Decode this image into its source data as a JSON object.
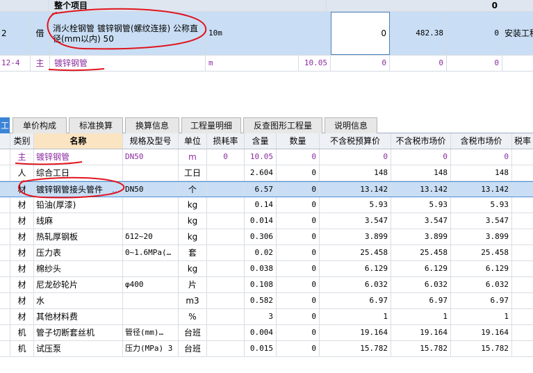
{
  "top": {
    "group_row": {
      "label": "整个项目",
      "total": "0"
    },
    "main_row": {
      "code": "2",
      "type": "借",
      "name": "消火栓钢管 镀锌钢管(螺纹连接) 公称直径(mm以内) 50",
      "unit": "10m",
      "qty": "0",
      "price": "482.38",
      "amount": "0",
      "category": "安装工程"
    },
    "sub_row": {
      "code": "12-4",
      "type": "主",
      "name": "镀锌钢管",
      "unit": "m",
      "content": "10.05",
      "qty": "0",
      "price": "0",
      "amount": "0"
    }
  },
  "tabs": [
    {
      "label": "工"
    },
    {
      "label": "单价构成"
    },
    {
      "label": "标准换算"
    },
    {
      "label": "换算信息"
    },
    {
      "label": "工程量明细"
    },
    {
      "label": "反查图形工程量"
    },
    {
      "label": "说明信息"
    }
  ],
  "table": {
    "headers": [
      "",
      "类别",
      "名称",
      "规格及型号",
      "单位",
      "损耗率",
      "含量",
      "数量",
      "不含税预算价",
      "不含税市场价",
      "含税市场价",
      "税率"
    ],
    "rows": [
      {
        "type": "主",
        "name": "镀锌钢管",
        "spec": "DN50",
        "unit": "m",
        "loss": "0",
        "content": "10.05",
        "qty": "0",
        "p1": "0",
        "p2": "0",
        "p3": "0"
      },
      {
        "type": "人",
        "name": "综合工日",
        "spec": "",
        "unit": "工日",
        "loss": "",
        "content": "2.604",
        "qty": "0",
        "p1": "148",
        "p2": "148",
        "p3": "148"
      },
      {
        "type": "材",
        "name": "镀锌钢管接头管件",
        "spec": "DN50",
        "unit": "个",
        "loss": "",
        "content": "6.57",
        "qty": "0",
        "p1": "13.142",
        "p2": "13.142",
        "p3": "13.142"
      },
      {
        "type": "材",
        "name": "铅油(厚漆)",
        "spec": "",
        "unit": "kg",
        "loss": "",
        "content": "0.14",
        "qty": "0",
        "p1": "5.93",
        "p2": "5.93",
        "p3": "5.93"
      },
      {
        "type": "材",
        "name": "线麻",
        "spec": "",
        "unit": "kg",
        "loss": "",
        "content": "0.014",
        "qty": "0",
        "p1": "3.547",
        "p2": "3.547",
        "p3": "3.547"
      },
      {
        "type": "材",
        "name": "热轧厚钢板",
        "spec": "δ12~20",
        "unit": "kg",
        "loss": "",
        "content": "0.306",
        "qty": "0",
        "p1": "3.899",
        "p2": "3.899",
        "p3": "3.899"
      },
      {
        "type": "材",
        "name": "压力表",
        "spec": "0~1.6MPa(…",
        "unit": "套",
        "loss": "",
        "content": "0.02",
        "qty": "0",
        "p1": "25.458",
        "p2": "25.458",
        "p3": "25.458"
      },
      {
        "type": "材",
        "name": "棉纱头",
        "spec": "",
        "unit": "kg",
        "loss": "",
        "content": "0.038",
        "qty": "0",
        "p1": "6.129",
        "p2": "6.129",
        "p3": "6.129"
      },
      {
        "type": "材",
        "name": "尼龙砂轮片",
        "spec": "φ400",
        "unit": "片",
        "loss": "",
        "content": "0.108",
        "qty": "0",
        "p1": "6.032",
        "p2": "6.032",
        "p3": "6.032"
      },
      {
        "type": "材",
        "name": "水",
        "spec": "",
        "unit": "m3",
        "loss": "",
        "content": "0.582",
        "qty": "0",
        "p1": "6.97",
        "p2": "6.97",
        "p3": "6.97"
      },
      {
        "type": "材",
        "name": "其他材料费",
        "spec": "",
        "unit": "%",
        "loss": "",
        "content": "3",
        "qty": "0",
        "p1": "1",
        "p2": "1",
        "p3": "1"
      },
      {
        "type": "机",
        "name": "管子切断套丝机",
        "spec": "管径(mm)…",
        "unit": "台班",
        "loss": "",
        "content": "0.004",
        "qty": "0",
        "p1": "19.164",
        "p2": "19.164",
        "p3": "19.164"
      },
      {
        "type": "机",
        "name": "试压泵",
        "spec": "压力(MPa) 3",
        "unit": "台班",
        "loss": "",
        "content": "0.015",
        "qty": "0",
        "p1": "15.782",
        "p2": "15.782",
        "p3": "15.782"
      }
    ]
  },
  "colors": {
    "selection": "#c9def4",
    "tab_active": "#3c84d6",
    "main_material_text": "#8d2ca0",
    "annotation": "#e0141e"
  }
}
